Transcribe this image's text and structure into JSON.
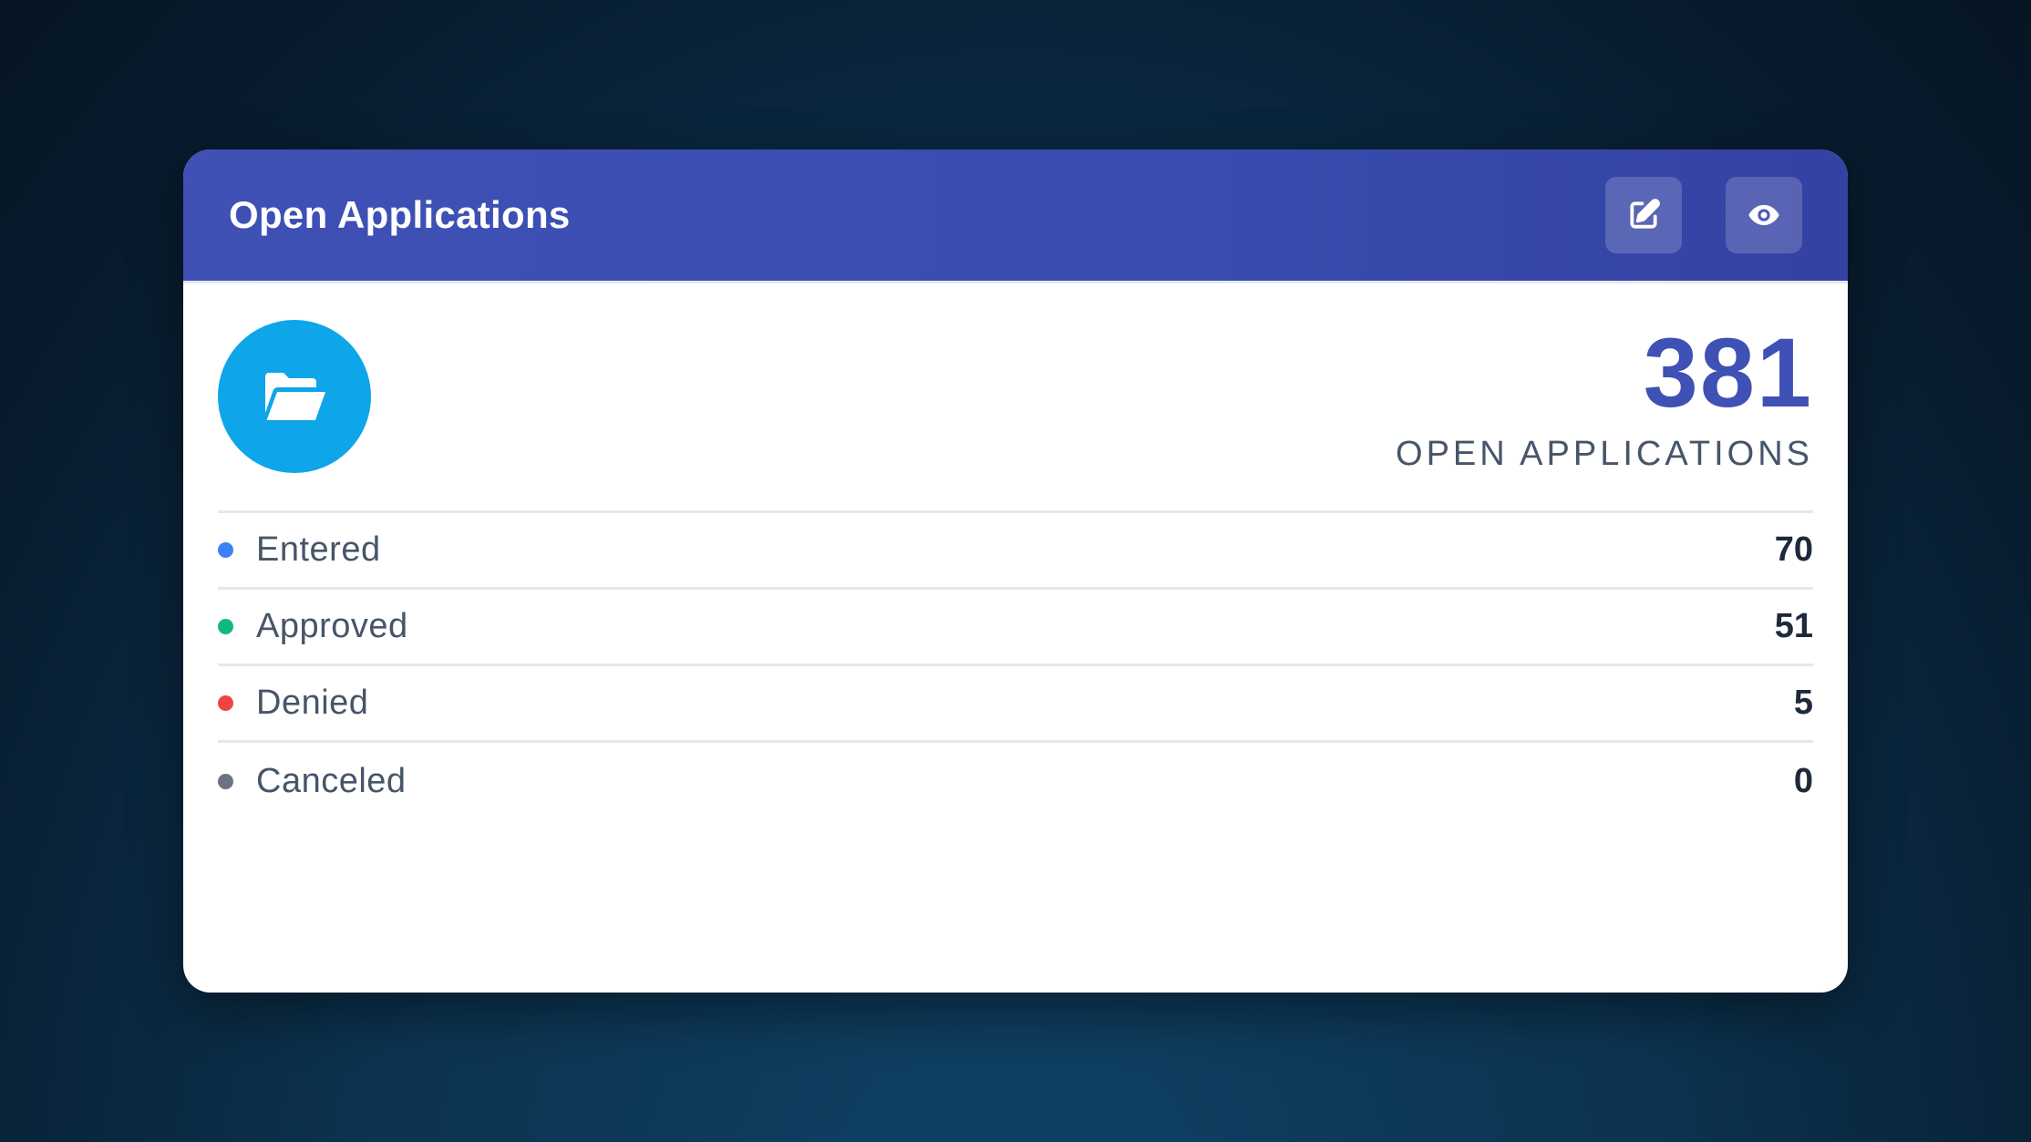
{
  "card": {
    "title": "Open Applications",
    "actions": [
      {
        "name": "edit",
        "icon": "edit-icon"
      },
      {
        "name": "view",
        "icon": "eye-icon"
      }
    ]
  },
  "summary": {
    "icon": "folder-open-icon",
    "total": "381",
    "label": "OPEN APPLICATIONS"
  },
  "statuses": [
    {
      "label": "Entered",
      "count": "70",
      "color": "#3b82f6"
    },
    {
      "label": "Approved",
      "count": "51",
      "color": "#10b981"
    },
    {
      "label": "Denied",
      "count": "5",
      "color": "#ef4444"
    },
    {
      "label": "Canceled",
      "count": "0",
      "color": "#6b7280"
    }
  ],
  "colors": {
    "header": "#3f51b5",
    "accent": "#0ea5e9",
    "total": "#3f51b5"
  }
}
